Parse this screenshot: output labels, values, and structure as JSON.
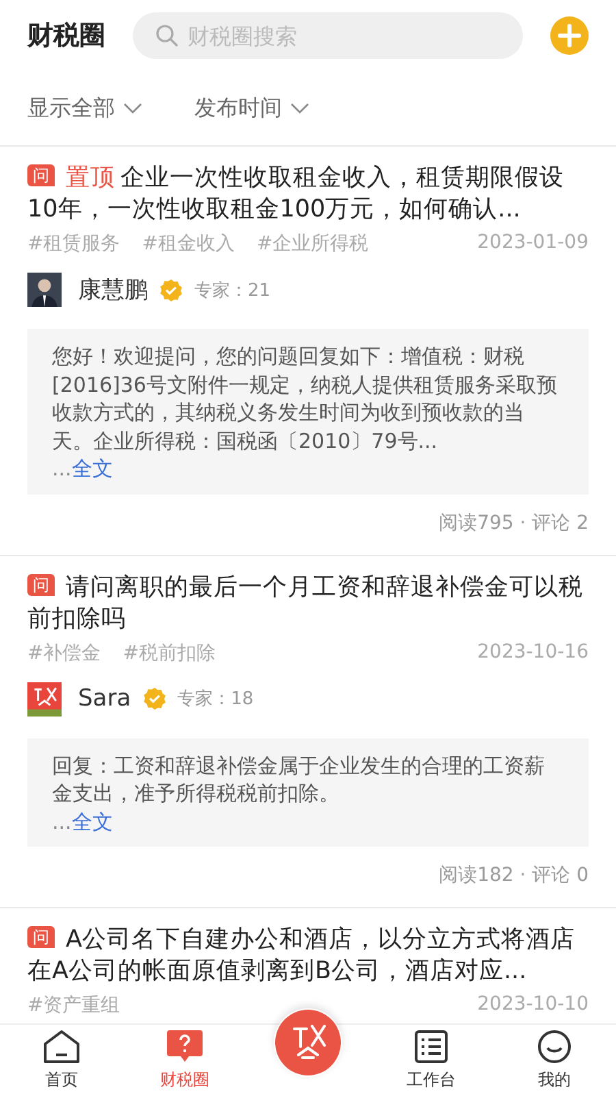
{
  "header": {
    "title": "财税圈",
    "search": {
      "placeholder": "财税圈搜索"
    }
  },
  "filters": [
    {
      "label": "显示全部"
    },
    {
      "label": "发布时间"
    }
  ],
  "posts": [
    {
      "badge": "问",
      "pinned_label": "置顶",
      "title": "企业一次性收取租金收入，租赁期限假设10年，一次性收取租金100万元，如何确认...",
      "tags": [
        "#租赁服务",
        "#租金收入",
        "#企业所得税"
      ],
      "date": "2023-01-09",
      "author": {
        "name": "康慧鹏",
        "avatar": {
          "kind": "person"
        },
        "verified": true,
        "expert": "专家：21"
      },
      "answer": "您好！欢迎提问，您的问题回复如下：增值税：财税[2016]36号文附件一规定，纳税人提供租赁服务采取预收款方式的，其纳税义务发生时间为收到预收款的当天。企业所得税：国税函〔2010〕79号...",
      "more": {
        "prefix": "...",
        "link": "全文"
      },
      "stats": "阅读795 · 评论 2"
    },
    {
      "badge": "问",
      "title": "请问离职的最后一个月工资和辞退补偿金可以税前扣除吗",
      "tags": [
        "#补偿金",
        "#税前扣除"
      ],
      "date": "2023-10-16",
      "author": {
        "name": "Sara",
        "avatar": {
          "kind": "logo"
        },
        "verified": true,
        "expert": "专家：18"
      },
      "answer": "回复：工资和辞退补偿金属于企业发生的合理的工资薪金支出，准予所得税税前扣除。",
      "more": {
        "prefix": "...",
        "link": "全文"
      },
      "stats": "阅读182 · 评论 0"
    },
    {
      "badge": "问",
      "title": "A公司名下自建办公和酒店，以分立方式将酒店在A公司的帐面原值剥离到B公司，酒店对应...",
      "tags": [
        "#资产重组"
      ],
      "date": "2023-10-10"
    }
  ],
  "tabbar": [
    {
      "kind": "home",
      "label": "首页",
      "selected": false
    },
    {
      "kind": "question",
      "label": "财税圈",
      "selected": true
    },
    {
      "kind": "center"
    },
    {
      "kind": "list",
      "label": "工作台",
      "selected": false
    },
    {
      "kind": "smile",
      "label": "我的",
      "selected": false
    }
  ]
}
